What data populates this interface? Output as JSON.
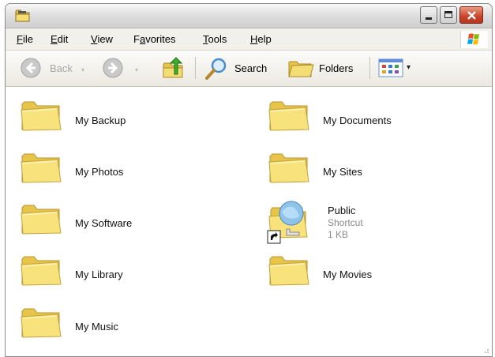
{
  "menu": [
    {
      "label": "File",
      "u": "F",
      "rest": "ile"
    },
    {
      "label": "Edit",
      "u": "E",
      "rest": "dit"
    },
    {
      "label": "View",
      "u": "V",
      "rest": "iew"
    },
    {
      "label": "Favorites",
      "pre": "F",
      "u": "a",
      "rest": "vorites"
    },
    {
      "label": "Tools",
      "u": "T",
      "rest": "ools"
    },
    {
      "label": "Help",
      "u": "H",
      "rest": "elp"
    }
  ],
  "toolbar": {
    "back_label": "Back",
    "search_label": "Search",
    "folders_label": "Folders"
  },
  "items": [
    {
      "label": "My Backup",
      "icon": "folder-icon"
    },
    {
      "label": "My Documents",
      "icon": "folder-icon"
    },
    {
      "label": "My Photos",
      "icon": "folder-icon"
    },
    {
      "label": "My Sites",
      "icon": "folder-icon"
    },
    {
      "label": "My Software",
      "icon": "folder-icon"
    },
    {
      "label": "Public",
      "type": "Shortcut",
      "size": "1 KB",
      "icon": "shared-folder-shortcut-icon"
    },
    {
      "label": "My Library",
      "icon": "folder-icon"
    },
    {
      "label": "My Movies",
      "icon": "folder-icon"
    },
    {
      "label": "My Music",
      "icon": "folder-icon"
    }
  ],
  "colors": {
    "folder_front": "#f6e27a",
    "folder_back": "#e9c94a",
    "close_button": "#c9432a"
  }
}
